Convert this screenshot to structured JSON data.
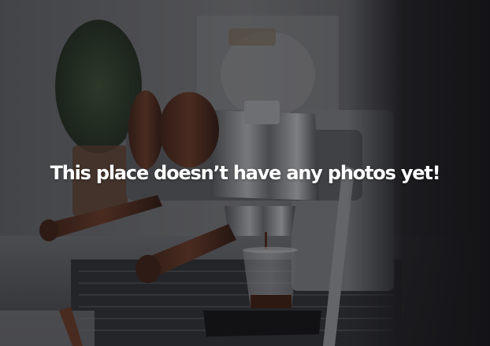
{
  "empty_state": {
    "message": "This place doesn’t have any photos yet!"
  },
  "background": {
    "subject": "espresso-machine-photo",
    "overlay_color": "#08080c"
  }
}
